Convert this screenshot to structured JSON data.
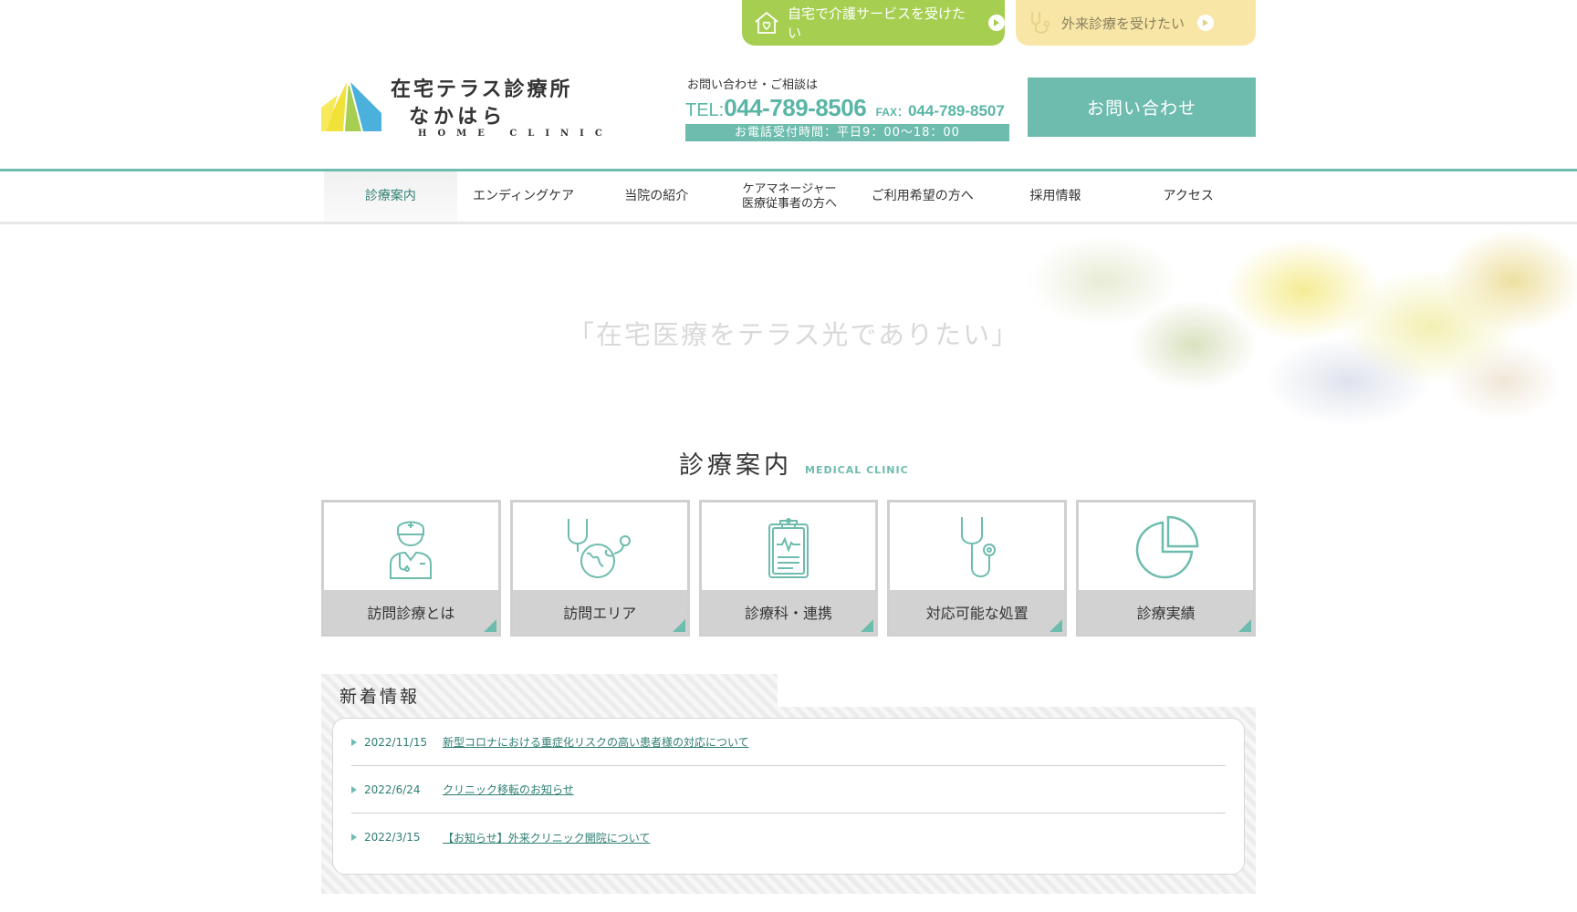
{
  "top_tabs": {
    "care_label": "自宅で介護サービスを受けたい",
    "outpatient_label": "外来診療を受けたい"
  },
  "logo": {
    "title": "在宅テラス診療所",
    "subtitle": "なかはら",
    "english": "HOME CLINIC"
  },
  "contact": {
    "lead": "お問い合わせ・ご相談は",
    "tel_label": "TEL:",
    "tel": "044-789-8506",
    "fax_label": "FAX：",
    "fax": "044-789-8507",
    "hours": "お電話受付時間：平日9：00〜18：00"
  },
  "inquiry_button": "お問い合わせ",
  "nav": {
    "items": [
      {
        "label": "診療案内"
      },
      {
        "label": "エンディングケア"
      },
      {
        "label": "当院の紹介"
      },
      {
        "label": "ケアマネージャー\n医療従事者の方へ"
      },
      {
        "label": "ご利用希望の方へ"
      },
      {
        "label": "採用情報"
      },
      {
        "label": "アクセス"
      }
    ]
  },
  "hero": {
    "catchphrase": "「在宅医療をテラス光でありたい」"
  },
  "section": {
    "title_jp": "診療案内",
    "title_en": "MEDICAL CLINIC"
  },
  "cards": [
    {
      "label": "訪問診療とは",
      "icon": "doctor-icon"
    },
    {
      "label": "訪問エリア",
      "icon": "stethoscope-globe-icon"
    },
    {
      "label": "診療科・連携",
      "icon": "clipboard-icon"
    },
    {
      "label": "対応可能な処置",
      "icon": "stethoscope-icon"
    },
    {
      "label": "診療実績",
      "icon": "pie-chart-icon"
    }
  ],
  "news": {
    "title": "新着情報",
    "items": [
      {
        "date": "2022/11/15",
        "title": "新型コロナにおける重症化リスクの高い患者様の対応について"
      },
      {
        "date": "2022/6/24",
        "title": "クリニック移転のお知らせ"
      },
      {
        "date": "2022/3/15",
        "title": "【お知らせ】外来クリニック開院について"
      }
    ]
  },
  "colors": {
    "accent": "#6dbcae",
    "care_tab": "#a6cf52",
    "outpatient_tab": "#f7e6a6",
    "card_label_bg": "#d2d2d2"
  }
}
